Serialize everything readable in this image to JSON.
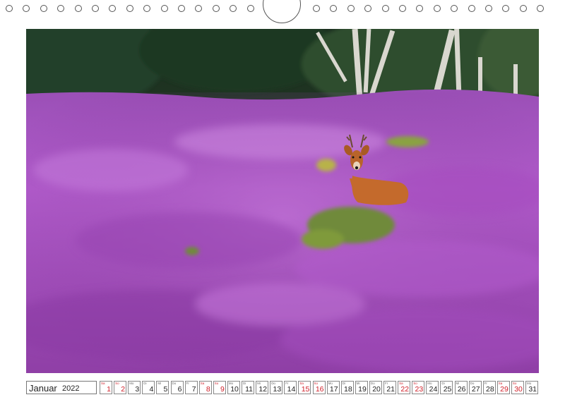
{
  "calendar": {
    "month": "Januar",
    "year": "2022",
    "days": [
      {
        "dow": "Sa",
        "num": "1",
        "weekend": true
      },
      {
        "dow": "So",
        "num": "2",
        "weekend": true
      },
      {
        "dow": "Mo",
        "num": "3",
        "weekend": false
      },
      {
        "dow": "Di",
        "num": "4",
        "weekend": false
      },
      {
        "dow": "Mi",
        "num": "5",
        "weekend": false
      },
      {
        "dow": "Do",
        "num": "6",
        "weekend": false
      },
      {
        "dow": "Fr",
        "num": "7",
        "weekend": false
      },
      {
        "dow": "Sa",
        "num": "8",
        "weekend": true
      },
      {
        "dow": "So",
        "num": "9",
        "weekend": true
      },
      {
        "dow": "Mo",
        "num": "10",
        "weekend": false
      },
      {
        "dow": "Di",
        "num": "11",
        "weekend": false
      },
      {
        "dow": "Mi",
        "num": "12",
        "weekend": false
      },
      {
        "dow": "Do",
        "num": "13",
        "weekend": false
      },
      {
        "dow": "Fr",
        "num": "14",
        "weekend": false
      },
      {
        "dow": "Sa",
        "num": "15",
        "weekend": true
      },
      {
        "dow": "So",
        "num": "16",
        "weekend": true
      },
      {
        "dow": "Mo",
        "num": "17",
        "weekend": false
      },
      {
        "dow": "Di",
        "num": "18",
        "weekend": false
      },
      {
        "dow": "Mi",
        "num": "19",
        "weekend": false
      },
      {
        "dow": "Do",
        "num": "20",
        "weekend": false
      },
      {
        "dow": "Fr",
        "num": "21",
        "weekend": false
      },
      {
        "dow": "Sa",
        "num": "22",
        "weekend": true
      },
      {
        "dow": "So",
        "num": "23",
        "weekend": true
      },
      {
        "dow": "Mo",
        "num": "24",
        "weekend": false
      },
      {
        "dow": "Di",
        "num": "25",
        "weekend": false
      },
      {
        "dow": "Mi",
        "num": "26",
        "weekend": false
      },
      {
        "dow": "Do",
        "num": "27",
        "weekend": false
      },
      {
        "dow": "Fr",
        "num": "28",
        "weekend": false
      },
      {
        "dow": "Sa",
        "num": "29",
        "weekend": true
      },
      {
        "dow": "So",
        "num": "30",
        "weekend": true
      },
      {
        "dow": "Mo",
        "num": "31",
        "weekend": false
      }
    ]
  },
  "photo": {
    "subject": "roe-deer-in-heather",
    "colors": {
      "heather": "#b04fc8",
      "forest": "#1f3a26",
      "deer": "#c86a2a"
    }
  },
  "colors": {
    "weekend": "#d0202a",
    "text": "#222222",
    "border": "#888888"
  }
}
